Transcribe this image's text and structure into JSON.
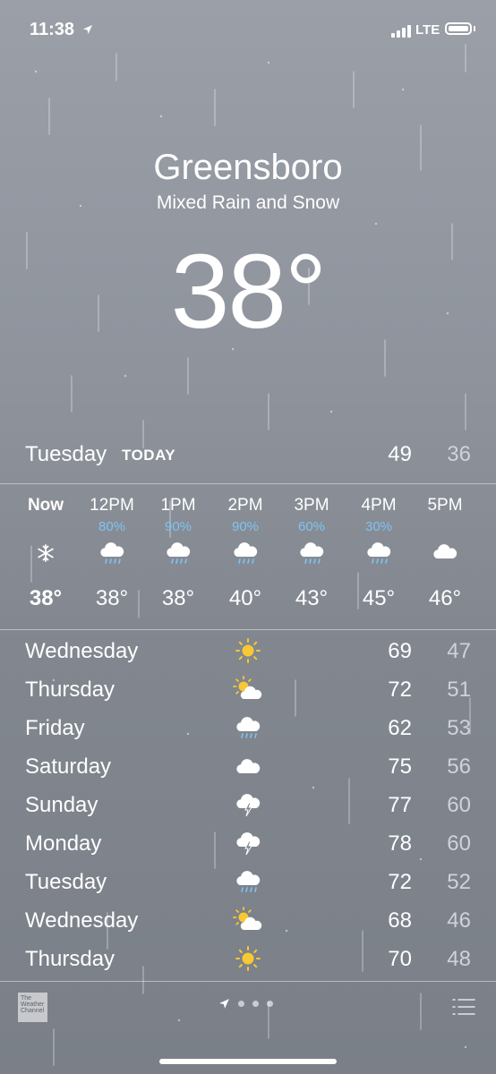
{
  "status_bar": {
    "time": "11:38",
    "network": "LTE"
  },
  "location": {
    "city": "Greensboro",
    "condition": "Mixed Rain and Snow",
    "current_temp": "38°"
  },
  "today": {
    "day": "Tuesday",
    "tag": "TODAY",
    "high": "49",
    "low": "36"
  },
  "hourly": [
    {
      "time": "Now",
      "chance": "",
      "icon": "snowflake-icon",
      "temp": "38°"
    },
    {
      "time": "12PM",
      "chance": "80%",
      "icon": "rain-cloud-icon",
      "temp": "38°"
    },
    {
      "time": "1PM",
      "chance": "90%",
      "icon": "rain-cloud-icon",
      "temp": "38°"
    },
    {
      "time": "2PM",
      "chance": "90%",
      "icon": "rain-cloud-icon",
      "temp": "40°"
    },
    {
      "time": "3PM",
      "chance": "60%",
      "icon": "rain-cloud-icon",
      "temp": "43°"
    },
    {
      "time": "4PM",
      "chance": "30%",
      "icon": "rain-cloud-icon",
      "temp": "45°"
    },
    {
      "time": "5PM",
      "chance": "",
      "icon": "cloud-icon",
      "temp": "46°"
    }
  ],
  "daily": [
    {
      "day": "Wednesday",
      "icon": "sun-icon",
      "high": "69",
      "low": "47"
    },
    {
      "day": "Thursday",
      "icon": "partly-cloudy-icon",
      "high": "72",
      "low": "51"
    },
    {
      "day": "Friday",
      "icon": "rain-cloud-icon",
      "high": "62",
      "low": "53"
    },
    {
      "day": "Saturday",
      "icon": "cloud-icon",
      "high": "75",
      "low": "56"
    },
    {
      "day": "Sunday",
      "icon": "thunderstorm-icon",
      "high": "77",
      "low": "60"
    },
    {
      "day": "Monday",
      "icon": "thunderstorm-icon",
      "high": "78",
      "low": "60"
    },
    {
      "day": "Tuesday",
      "icon": "rain-cloud-icon",
      "high": "72",
      "low": "52"
    },
    {
      "day": "Wednesday",
      "icon": "partly-cloudy-icon",
      "high": "68",
      "low": "46"
    },
    {
      "day": "Thursday",
      "icon": "sun-icon",
      "high": "70",
      "low": "48"
    }
  ],
  "footer": {
    "logo_text": "The Weather Channel"
  },
  "colors": {
    "precip_chance": "#7fc3f2",
    "sun": "#f7c834",
    "low_temp": "#cfd2d8"
  }
}
